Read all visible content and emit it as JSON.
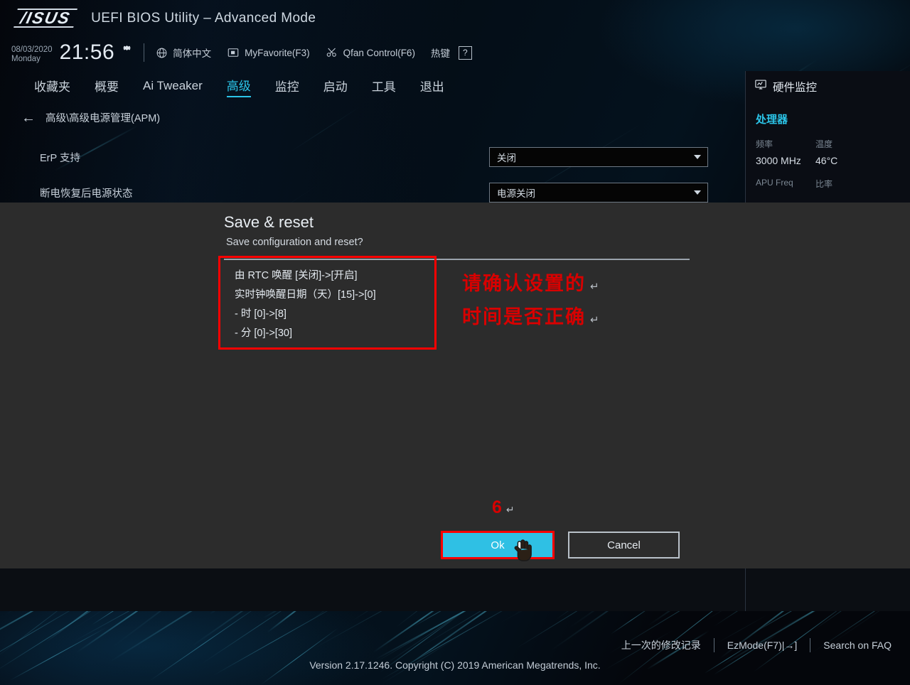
{
  "header": {
    "logo": "/ISUS",
    "title": "UEFI BIOS Utility – Advanced Mode",
    "date": "08/03/2020",
    "weekday": "Monday",
    "time": "21:56",
    "gear_icon": "gear-icon",
    "items": [
      {
        "icon": "globe-icon",
        "label": "简体中文"
      },
      {
        "icon": "folder-star-icon",
        "label": "MyFavorite(F3)"
      },
      {
        "icon": "fan-icon",
        "label": "Qfan Control(F6)"
      },
      {
        "icon": "hotkey-icon",
        "label": "热键",
        "key": "?"
      }
    ]
  },
  "tabs": [
    {
      "label": "收藏夹",
      "active": false
    },
    {
      "label": "概要",
      "active": false
    },
    {
      "label": "Ai Tweaker",
      "active": false
    },
    {
      "label": "高级",
      "active": true
    },
    {
      "label": "监控",
      "active": false
    },
    {
      "label": "启动",
      "active": false
    },
    {
      "label": "工具",
      "active": false
    },
    {
      "label": "退出",
      "active": false
    }
  ],
  "breadcrumb": {
    "back_icon": "back-arrow-icon",
    "path": "高级\\高级电源管理(APM)"
  },
  "settings": [
    {
      "label": "ErP 支持",
      "value": "关闭"
    },
    {
      "label": "断电恢复后电源状态",
      "value": "电源关闭"
    }
  ],
  "hardware_monitor": {
    "icon": "monitor-icon",
    "title": "硬件监控",
    "section": "处理器",
    "rows": [
      {
        "key": "频率",
        "value": "3000 MHz"
      },
      {
        "key": "温度",
        "value": "46°C"
      }
    ],
    "rows2": [
      {
        "key": "APU Freq",
        "value": ""
      },
      {
        "key": "比率",
        "value": ""
      }
    ]
  },
  "dialog": {
    "title": "Save & reset",
    "subtitle": "Save configuration and reset?",
    "changes": [
      "由 RTC 唤醒 [关闭]->[开启]",
      "实时钟唤醒日期（天）[15]->[0]",
      "- 时 [0]->[8]",
      "- 分 [0]->[30]"
    ],
    "ok_label": "Ok",
    "cancel_label": "Cancel",
    "cursor_icon": "hand-cursor-icon"
  },
  "annotations": {
    "note_line1": "请确认设置的",
    "note_line2": "时间是否正确",
    "pilcrow": "↵",
    "step_number": "6",
    "color": "#d80000"
  },
  "status_bar": {
    "last_modified": "上一次的修改记录",
    "ez_mode": "EzMode(F7)|→]",
    "search_faq": "Search on FAQ"
  },
  "version": "Version 2.17.1246. Copyright (C) 2019 American Megatrends, Inc.",
  "colors": {
    "accent_cyan": "#2bc4e8",
    "ok_button": "#2fc0e4",
    "annotation_red": "#d80000",
    "highlight_box": "#ff0000"
  }
}
